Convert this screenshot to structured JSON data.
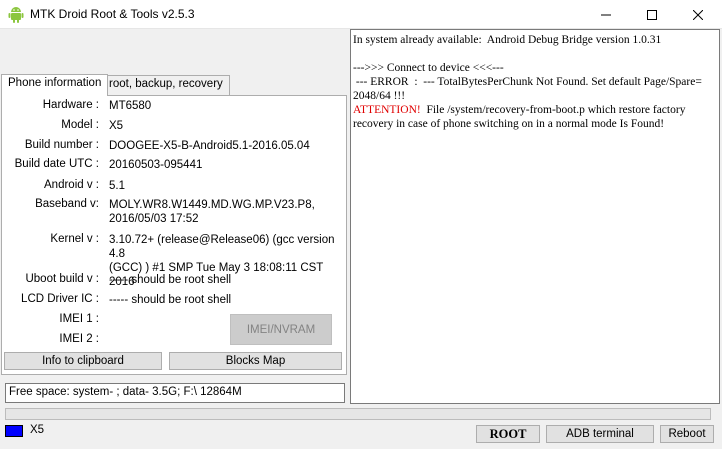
{
  "window": {
    "title": "MTK Droid Root & Tools v2.5.3"
  },
  "tabs": [
    {
      "label": "Phone information"
    },
    {
      "label": "root, backup, recovery"
    }
  ],
  "phone_info": {
    "hardware_label": "Hardware :",
    "hardware": "MT6580",
    "model_label": "Model :",
    "model": "X5",
    "build_number_label": "Build number :",
    "build_number": "DOOGEE-X5-B-Android5.1-2016.05.04",
    "build_date_label": "Build date UTC :",
    "build_date": "20160503-095441",
    "android_label": "Android  v :",
    "android": "5.1",
    "baseband_label": "Baseband v:",
    "baseband": "MOLY.WR8.W1449.MD.WG.MP.V23.P8,\n2016/05/03 17:52",
    "kernel_label": "Kernel v :",
    "kernel": "3.10.72+ (release@Release06) (gcc version 4.8\n(GCC) ) #1 SMP  Tue May 3 18:08:11 CST 2016",
    "uboot_label": "Uboot build v :",
    "uboot": "----- should be  root shell",
    "lcd_label": "LCD Driver IC :",
    "lcd": "----- should be  root shell",
    "imei1_label": "IMEI 1 :",
    "imei2_label": "IMEI 2 :"
  },
  "buttons": {
    "imei_nvram": "IMEI/NVRAM",
    "info_clipboard": "Info to clipboard",
    "blocks_map": "Blocks Map",
    "root": "ROOT",
    "adb_terminal": "ADB terminal",
    "reboot": "Reboot"
  },
  "free_space": "Free space: system- ; data- 3.5G;  F:\\ 12864M",
  "log": {
    "line1": "In system already available:  Android Debug Bridge version 1.0.31",
    "line2": "--->>> Connect to device <<<---",
    "line3": " --- ERROR  :  --- TotalBytesPerChunk Not Found. Set default Page/Spare=\n2048/64 !!!",
    "attention": "ATTENTION!",
    "line4": "  File /system/recovery-from-boot.p which restore factory\nrecovery in case of phone switching on in a normal mode Is Found!"
  },
  "status": {
    "device": "X5",
    "device_color": "#0000ff"
  },
  "progress": 0,
  "icons": {
    "app": "android-icon",
    "minimize": "minimize-icon",
    "maximize": "maximize-icon",
    "close": "close-icon"
  }
}
